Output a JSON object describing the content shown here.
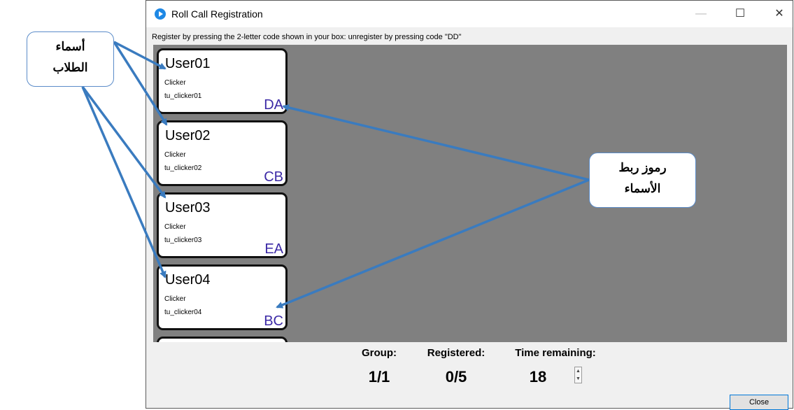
{
  "window": {
    "title": "Roll Call Registration",
    "controls": {
      "minimize": "—",
      "maximize": "☐",
      "close": "✕"
    },
    "instruction": "Register by pressing the 2-letter code shown in your box: unregister by pressing code \"DD\"",
    "users": [
      {
        "name": "User01",
        "type": "Clicker",
        "device": "tu_clicker01",
        "code": "DA"
      },
      {
        "name": "User02",
        "type": "Clicker",
        "device": "tu_clicker02",
        "code": "CB"
      },
      {
        "name": "User03",
        "type": "Clicker",
        "device": "tu_clicker03",
        "code": "EA"
      },
      {
        "name": "User04",
        "type": "Clicker",
        "device": "tu_clicker04",
        "code": "BC"
      }
    ],
    "stats": {
      "group_label": "Group:",
      "group_value": "1/1",
      "registered_label": "Registered:",
      "registered_value": "0/5",
      "time_label": "Time remaining:",
      "time_value": "18"
    },
    "close_button": "Close"
  },
  "annotations": {
    "names_callout": {
      "line1": "أسماء",
      "line2": "الطلاب"
    },
    "codes_callout": {
      "line1": "رموز ربط",
      "line2": "الأسماء"
    },
    "arrow_color": "#3a7bbf"
  }
}
